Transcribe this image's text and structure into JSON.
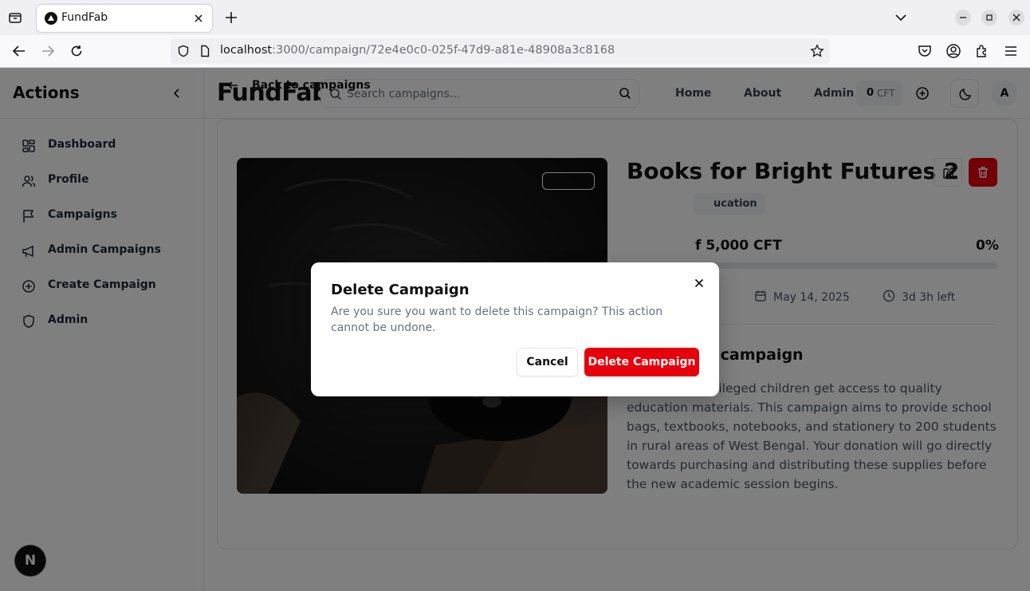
{
  "browser": {
    "tab_title": "FundFab",
    "url_host": "localhost",
    "url_rest": ":3000/campaign/72e4e0c0-025f-47d9-a81e-48908a3c8168"
  },
  "sidebar": {
    "title": "Actions",
    "items": [
      {
        "label": "Dashboard",
        "icon": "dashboard-icon"
      },
      {
        "label": "Profile",
        "icon": "users-icon"
      },
      {
        "label": "Campaigns",
        "icon": "flag-icon"
      },
      {
        "label": "Admin Campaigns",
        "icon": "megaphone-icon"
      },
      {
        "label": "Create Campaign",
        "icon": "plus-circle-icon"
      },
      {
        "label": "Admin",
        "icon": "shield-icon"
      }
    ]
  },
  "header": {
    "brand": "FundFab",
    "search_placeholder": "Search campaigns...",
    "links": [
      "Home",
      "About",
      "Admin"
    ],
    "cft_amount": "0",
    "cft_unit": "CFT",
    "avatar_initial": "A"
  },
  "page": {
    "back_label": "Back to campaigns",
    "campaign_title": "Books for Bright Futures 2",
    "category": "ucation",
    "raised_text": "f 5,000 CFT",
    "percent": "0%",
    "progress_fraction": 0,
    "date": "May 14, 2025",
    "time_left": "3d 3h left",
    "about_heading": "About this campaign",
    "about_text": "Help underprivileged children get access to quality education materials. This campaign aims to provide school bags, textbooks, notebooks, and stationery to 200 students in rural areas of West Bengal. Your donation will go directly towards purchasing and distributing these supplies before the new academic session begins."
  },
  "dialog": {
    "title": "Delete Campaign",
    "description": "Are you sure you want to delete this campaign? This action cannot be undone.",
    "cancel_label": "Cancel",
    "confirm_label": "Delete Campaign"
  },
  "dev_badge": "N",
  "colors": {
    "danger": "#e7000b",
    "overlay": "rgba(0,0,0,0.5)"
  }
}
